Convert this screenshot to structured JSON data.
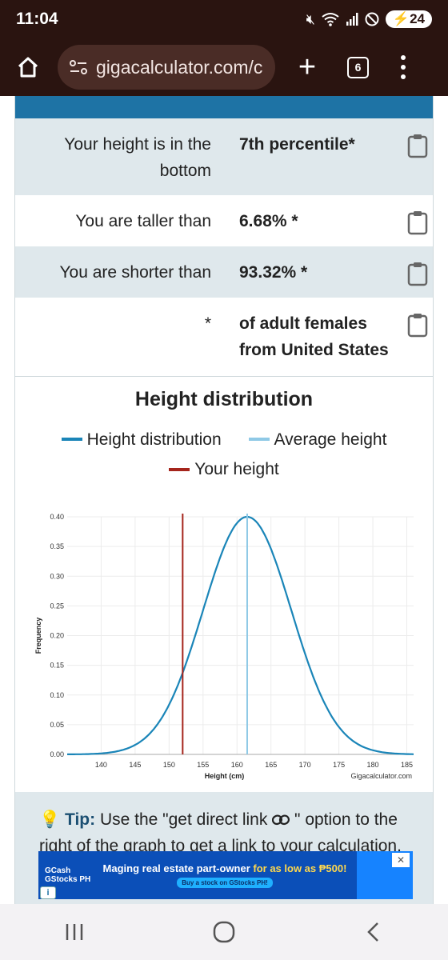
{
  "status": {
    "time": "11:04",
    "battery": "24"
  },
  "browser": {
    "url": "gigacalculator.com/c",
    "tab_count": "6"
  },
  "results": [
    {
      "label": "Your height is in the bottom",
      "value": "7th percentile*"
    },
    {
      "label": "You are taller than",
      "value": "6.68% *"
    },
    {
      "label": "You are shorter than",
      "value": "93.32% *"
    },
    {
      "label": "*",
      "value": "of adult females from United States"
    }
  ],
  "chart_data": {
    "type": "line",
    "title": "Height distribution",
    "xlabel": "Height (cm)",
    "ylabel": "Frequency",
    "xlim": [
      135,
      186
    ],
    "ylim": [
      0,
      0.4
    ],
    "x_ticks": [
      "140",
      "145",
      "150",
      "155",
      "160",
      "165",
      "170",
      "175",
      "180",
      "185"
    ],
    "y_ticks": [
      "0.00",
      "0.05",
      "0.10",
      "0.15",
      "0.20",
      "0.25",
      "0.30",
      "0.35",
      "0.40"
    ],
    "legend": [
      "Height distribution",
      "Average height",
      "Your height"
    ],
    "legend_placement": "top",
    "grid": true,
    "watermark": "Gigacalculator.com",
    "series": [
      {
        "name": "Height distribution",
        "kind": "normal-curve",
        "mean": 161.5,
        "sd": 6.5,
        "peak": 0.4,
        "color": "#1a85b8"
      },
      {
        "name": "Average height",
        "kind": "vertical-line",
        "x": 161.5,
        "color": "#8fc9e6"
      },
      {
        "name": "Your height",
        "kind": "vertical-line",
        "x": 152,
        "color": "#a5251c"
      }
    ]
  },
  "tip": {
    "icon": "lightbulb-icon",
    "strong": "Tip:",
    "text": "Use the \"get direct link",
    "text2": "\" option to the right of the graph to get a link to your calculation."
  },
  "ad": {
    "brand": "GCash GStocks PH",
    "headline_a": "Maging real estate part-owner",
    "headline_b": "for as low as ₱500!",
    "cta": "Buy a stock on GStocks PH!"
  },
  "colors": {
    "accent": "#1e73a5",
    "shaded_row": "#dfe8ec",
    "status_bar": "#2a1410"
  }
}
